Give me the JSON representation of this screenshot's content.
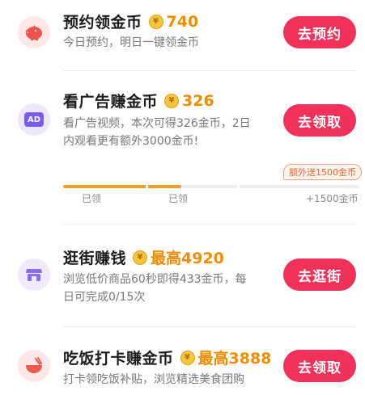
{
  "colors": {
    "accent": "#f0315a",
    "reward": "#f08c00",
    "progress": "#f0a028"
  },
  "coin_symbol": "¥",
  "tasks": [
    {
      "icon": "piggy-bank-icon",
      "title": "预约领金币",
      "reward": "740",
      "desc_lines": [
        "今日预约，明日一键领金币"
      ],
      "button": "去预约"
    },
    {
      "icon": "ad-icon",
      "icon_text": "AD",
      "title": "看广告赚金币",
      "reward": "326",
      "desc_lines": [
        "看广告视频，本次可得326金币，2日",
        "内观看更有额外3000金币!"
      ],
      "button": "去领取"
    },
    {
      "icon": "shop-icon",
      "title": "逛街赚钱",
      "reward": "最高4920",
      "desc_lines": [
        "浏览低价商品60秒即得433金币，每",
        "日可完成0/15次"
      ],
      "button": "去逛街"
    },
    {
      "icon": "bowl-icon",
      "title": "吃饭打卡赚金币",
      "reward": "最高3888",
      "desc_lines": [
        "打卡领吃饭补贴，浏览精选美食团购"
      ],
      "button": "去领取"
    }
  ],
  "progress": {
    "bonus_tag": "额外送1500金币",
    "milestones": [
      "已领",
      "已领",
      "+1500金币"
    ],
    "fraction": 0.4
  }
}
